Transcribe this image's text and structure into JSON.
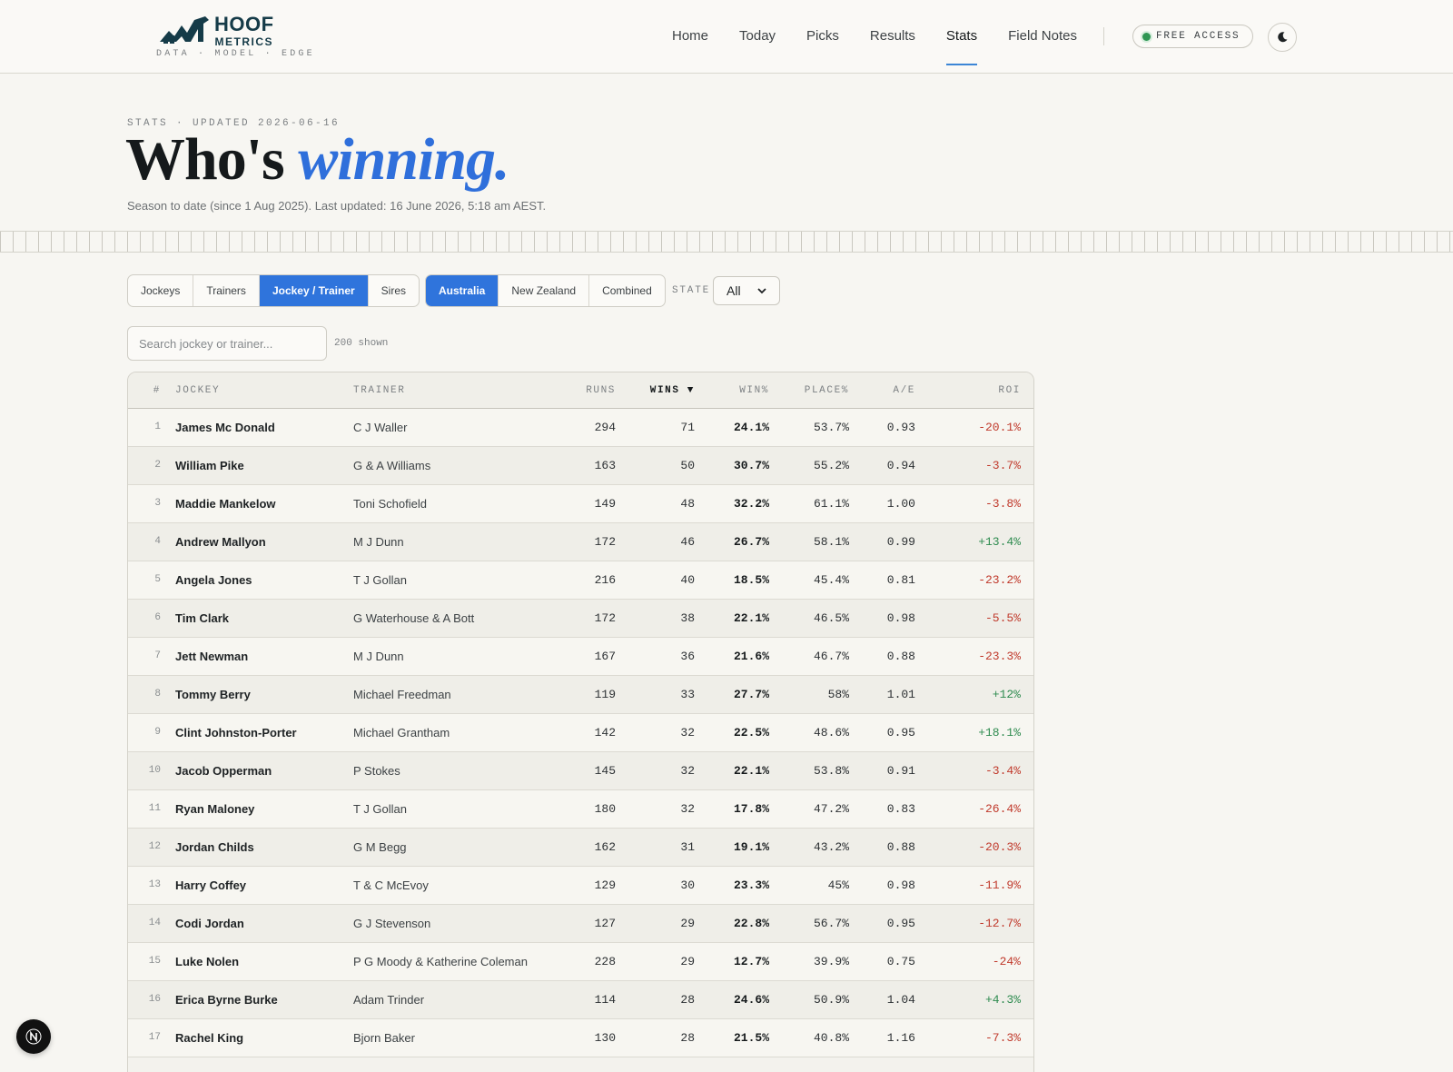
{
  "brand": {
    "name_line1": "HOOF",
    "name_line2": "METRICS",
    "tagline": "DATA · MODEL · EDGE",
    "accent": "#153b48"
  },
  "nav": {
    "items": [
      {
        "label": "Home"
      },
      {
        "label": "Today"
      },
      {
        "label": "Picks"
      },
      {
        "label": "Results"
      },
      {
        "label": "Stats",
        "active": true
      },
      {
        "label": "Field Notes"
      }
    ],
    "free_access_label": "FREE ACCESS",
    "theme_toggle_icon": "moon-icon"
  },
  "hero": {
    "eyebrow": "STATS · UPDATED 2026-06-16",
    "title_plain": "Who's ",
    "title_accent": "winning.",
    "subtitle": "Season to date (since 1 Aug 2025). Last updated: 16 June 2026, 5:18 am AEST."
  },
  "filters": {
    "category_tabs": [
      {
        "label": "Jockeys"
      },
      {
        "label": "Trainers"
      },
      {
        "label": "Jockey / Trainer",
        "selected": true
      },
      {
        "label": "Sires"
      }
    ],
    "region_tabs": [
      {
        "label": "Australia",
        "selected": true
      },
      {
        "label": "New Zealand"
      },
      {
        "label": "Combined"
      }
    ],
    "state_label": "STATE",
    "state_value": "All"
  },
  "search": {
    "placeholder": "Search jockey or trainer...",
    "value": "",
    "shown_count": "200 shown"
  },
  "table": {
    "headers": {
      "rank": "#",
      "jockey": "JOCKEY",
      "trainer": "TRAINER",
      "runs": "RUNS",
      "wins": "WINS ▼",
      "winpct": "WIN%",
      "place": "PLACE%",
      "ae": "A/E",
      "roi": "ROI"
    },
    "sorted_by": "wins",
    "rows": [
      {
        "rank": "1",
        "jockey": "James Mc Donald",
        "trainer": "C J Waller",
        "runs": "294",
        "wins": "71",
        "winpct": "24.1%",
        "place": "53.7%",
        "ae": "0.93",
        "roi": "-20.1%"
      },
      {
        "rank": "2",
        "jockey": "William Pike",
        "trainer": "G & A Williams",
        "runs": "163",
        "wins": "50",
        "winpct": "30.7%",
        "place": "55.2%",
        "ae": "0.94",
        "roi": "-3.7%"
      },
      {
        "rank": "3",
        "jockey": "Maddie Mankelow",
        "trainer": "Toni Schofield",
        "runs": "149",
        "wins": "48",
        "winpct": "32.2%",
        "place": "61.1%",
        "ae": "1.00",
        "roi": "-3.8%"
      },
      {
        "rank": "4",
        "jockey": "Andrew Mallyon",
        "trainer": "M J Dunn",
        "runs": "172",
        "wins": "46",
        "winpct": "26.7%",
        "place": "58.1%",
        "ae": "0.99",
        "roi": "+13.4%"
      },
      {
        "rank": "5",
        "jockey": "Angela Jones",
        "trainer": "T J Gollan",
        "runs": "216",
        "wins": "40",
        "winpct": "18.5%",
        "place": "45.4%",
        "ae": "0.81",
        "roi": "-23.2%"
      },
      {
        "rank": "6",
        "jockey": "Tim Clark",
        "trainer": "G Waterhouse & A Bott",
        "runs": "172",
        "wins": "38",
        "winpct": "22.1%",
        "place": "46.5%",
        "ae": "0.98",
        "roi": "-5.5%"
      },
      {
        "rank": "7",
        "jockey": "Jett Newman",
        "trainer": "M J Dunn",
        "runs": "167",
        "wins": "36",
        "winpct": "21.6%",
        "place": "46.7%",
        "ae": "0.88",
        "roi": "-23.3%"
      },
      {
        "rank": "8",
        "jockey": "Tommy Berry",
        "trainer": "Michael Freedman",
        "runs": "119",
        "wins": "33",
        "winpct": "27.7%",
        "place": "58%",
        "ae": "1.01",
        "roi": "+12%"
      },
      {
        "rank": "9",
        "jockey": "Clint Johnston-Porter",
        "trainer": "Michael Grantham",
        "runs": "142",
        "wins": "32",
        "winpct": "22.5%",
        "place": "48.6%",
        "ae": "0.95",
        "roi": "+18.1%"
      },
      {
        "rank": "10",
        "jockey": "Jacob Opperman",
        "trainer": "P Stokes",
        "runs": "145",
        "wins": "32",
        "winpct": "22.1%",
        "place": "53.8%",
        "ae": "0.91",
        "roi": "-3.4%"
      },
      {
        "rank": "11",
        "jockey": "Ryan Maloney",
        "trainer": "T J Gollan",
        "runs": "180",
        "wins": "32",
        "winpct": "17.8%",
        "place": "47.2%",
        "ae": "0.83",
        "roi": "-26.4%"
      },
      {
        "rank": "12",
        "jockey": "Jordan Childs",
        "trainer": "G M Begg",
        "runs": "162",
        "wins": "31",
        "winpct": "19.1%",
        "place": "43.2%",
        "ae": "0.88",
        "roi": "-20.3%"
      },
      {
        "rank": "13",
        "jockey": "Harry Coffey",
        "trainer": "T & C McEvoy",
        "runs": "129",
        "wins": "30",
        "winpct": "23.3%",
        "place": "45%",
        "ae": "0.98",
        "roi": "-11.9%"
      },
      {
        "rank": "14",
        "jockey": "Codi Jordan",
        "trainer": "G J Stevenson",
        "runs": "127",
        "wins": "29",
        "winpct": "22.8%",
        "place": "56.7%",
        "ae": "0.95",
        "roi": "-12.7%"
      },
      {
        "rank": "15",
        "jockey": "Luke Nolen",
        "trainer": "P G Moody & Katherine Coleman",
        "runs": "228",
        "wins": "29",
        "winpct": "12.7%",
        "place": "39.9%",
        "ae": "0.75",
        "roi": "-24%"
      },
      {
        "rank": "16",
        "jockey": "Erica Byrne Burke",
        "trainer": "Adam Trinder",
        "runs": "114",
        "wins": "28",
        "winpct": "24.6%",
        "place": "50.9%",
        "ae": "1.04",
        "roi": "+4.3%"
      },
      {
        "rank": "17",
        "jockey": "Rachel King",
        "trainer": "Bjorn Baker",
        "runs": "130",
        "wins": "28",
        "winpct": "21.5%",
        "place": "40.8%",
        "ae": "1.16",
        "roi": "-7.3%"
      }
    ]
  },
  "colors": {
    "accent": "#2f74dc",
    "roi_positive": "#2e8b4f",
    "roi_negative": "#c0392b"
  },
  "floating_button_icon": "n-logo-icon"
}
